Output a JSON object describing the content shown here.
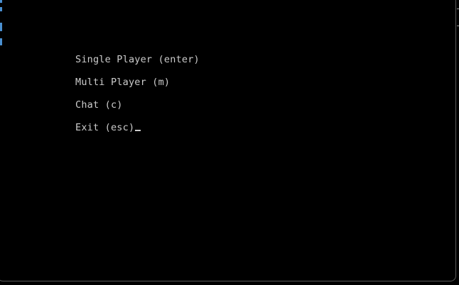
{
  "menu": {
    "items": [
      {
        "label": "Single Player (enter)"
      },
      {
        "label": "Multi Player (m)"
      },
      {
        "label": "Chat (c)"
      },
      {
        "label": "Exit (esc)"
      }
    ]
  },
  "colors": {
    "background": "#000000",
    "text": "#cccccc",
    "frame_border": "#5a5a5a",
    "accent_strip": "#4a8fd0"
  }
}
